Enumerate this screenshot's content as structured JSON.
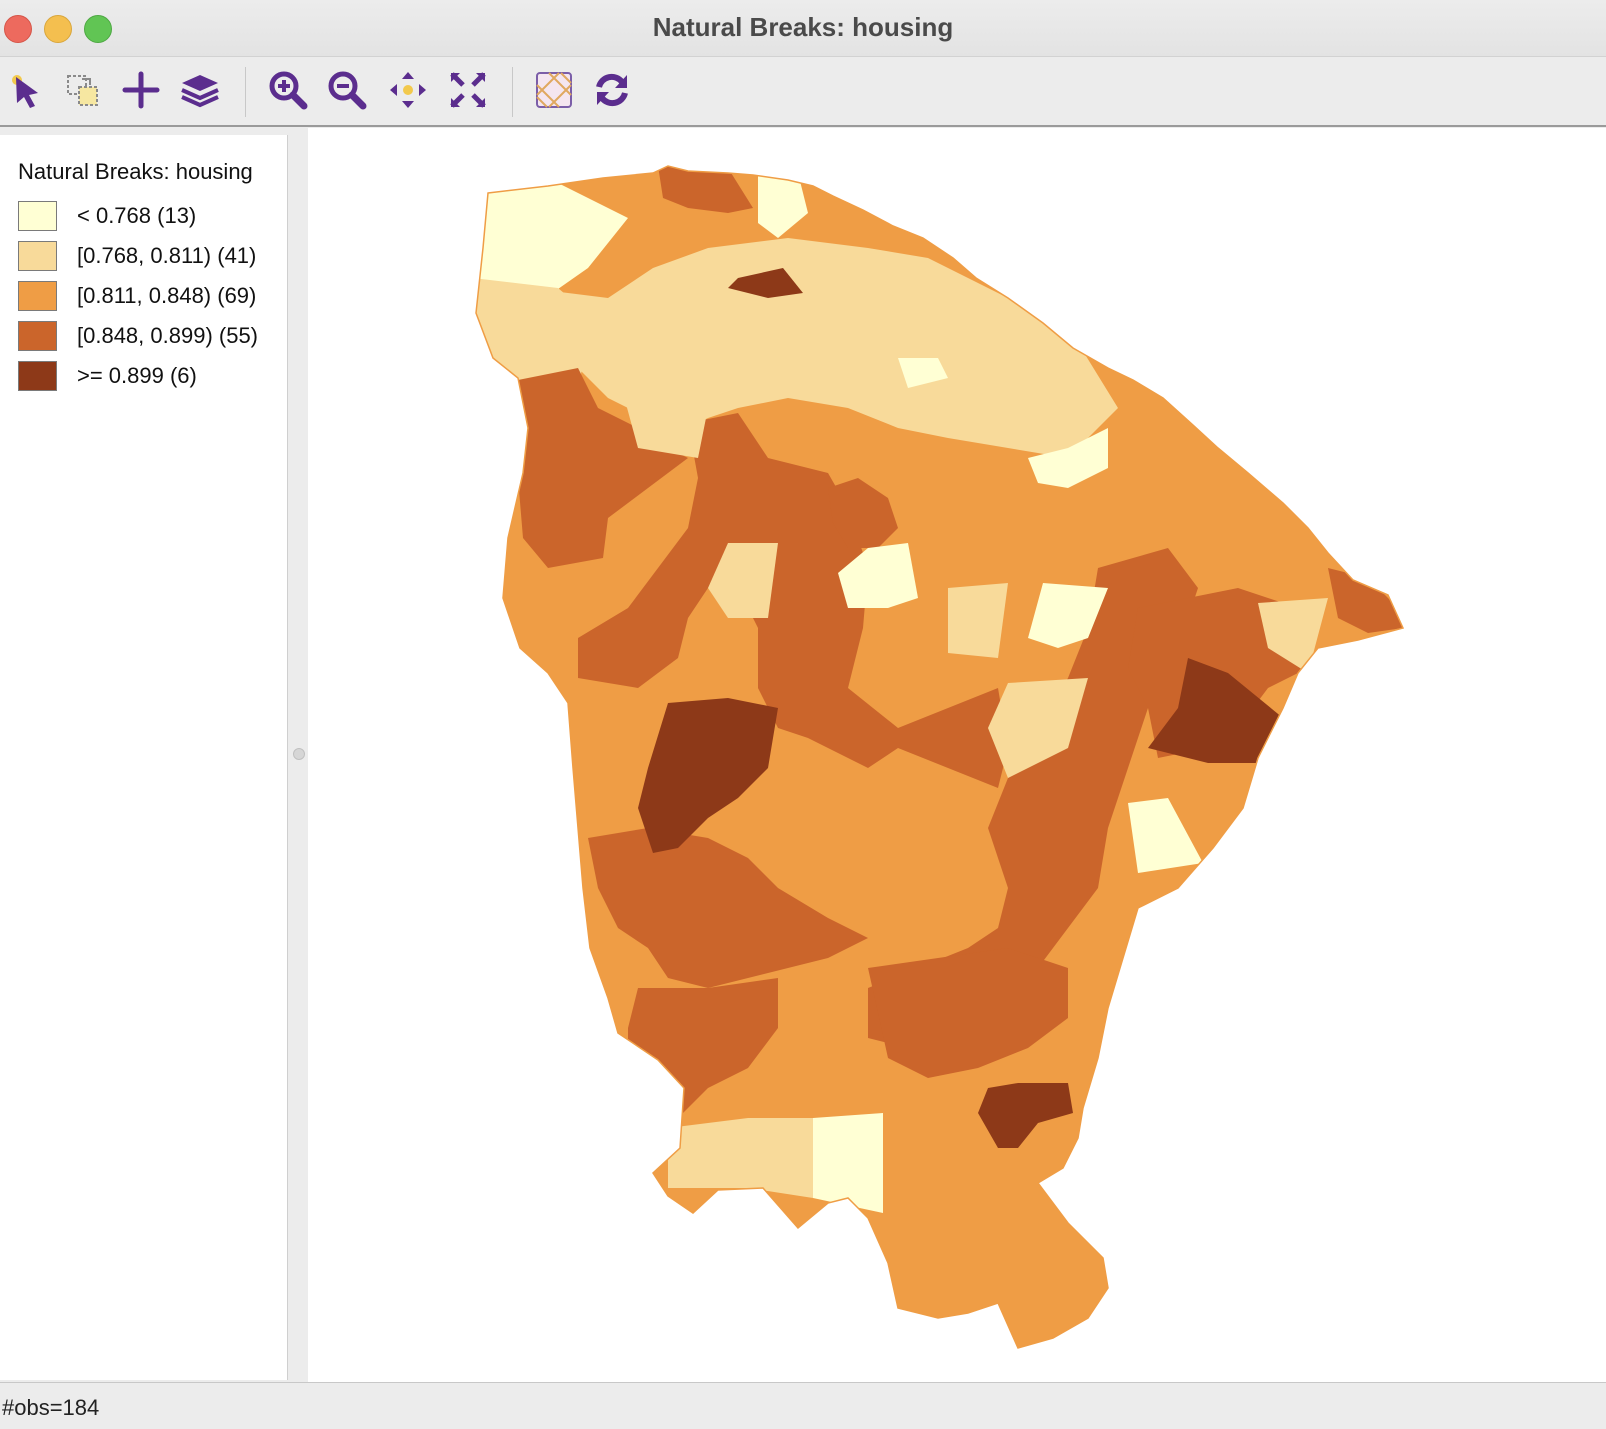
{
  "window": {
    "title": "Natural Breaks: housing"
  },
  "toolbar": {
    "tools": [
      {
        "icon": "select-arrow-icon"
      },
      {
        "icon": "selection-copy-icon"
      },
      {
        "icon": "add-layer-plus-icon"
      },
      {
        "icon": "layers-icon"
      },
      {
        "icon": "zoom-in-icon"
      },
      {
        "icon": "zoom-out-icon"
      },
      {
        "icon": "pan-icon"
      },
      {
        "icon": "full-extent-icon"
      },
      {
        "icon": "basemap-icon"
      },
      {
        "icon": "refresh-icon"
      }
    ]
  },
  "legend": {
    "title": "Natural Breaks: housing",
    "items": [
      {
        "label": "< 0.768 (13)",
        "color": "#ffffd4"
      },
      {
        "label": "[0.768, 0.811) (41)",
        "color": "#f8da9a"
      },
      {
        "label": "[0.811, 0.848) (69)",
        "color": "#ef9d45"
      },
      {
        "label": "[0.848, 0.899) (55)",
        "color": "#cb652b"
      },
      {
        "label": ">= 0.899 (6)",
        "color": "#8d3918"
      }
    ]
  },
  "map": {
    "layer": "housing",
    "classification": "Natural Breaks",
    "outline_color": "#ef9d45"
  },
  "status": {
    "text": "#obs=184"
  }
}
